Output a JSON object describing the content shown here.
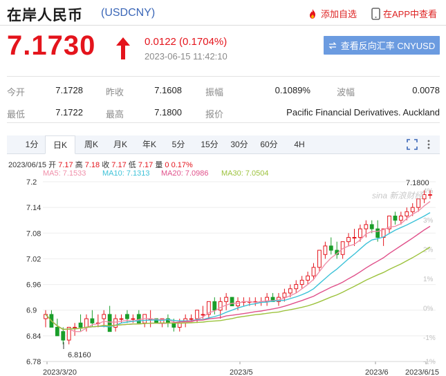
{
  "header": {
    "title": "在岸人民币",
    "code": "(USDCNY)",
    "add_watch": "添加自选",
    "open_app": "在APP中查看"
  },
  "quote": {
    "price": "7.1730",
    "change": "0.0122 (0.1704%)",
    "time": "2023-06-15 11:42:10",
    "reverse_button": "查看反向汇率 CNYUSD",
    "direction": "up",
    "up_color": "#e4141c"
  },
  "stats": {
    "open_label": "今开",
    "open": "7.1728",
    "prev_close_label": "昨收",
    "prev_close": "7.1608",
    "amplitude_label": "振幅",
    "amplitude": "0.1089%",
    "range_label": "波幅",
    "range": "0.0078",
    "low_label": "最低",
    "low": "7.1722",
    "high_label": "最高",
    "high": "7.1800",
    "source_label": "报价",
    "source": "Pacific Financial Derivatives. Auckland"
  },
  "tabs": [
    "1分",
    "日K",
    "周K",
    "月K",
    "年K",
    "5分",
    "15分",
    "30分",
    "60分",
    "4H"
  ],
  "active_tab": "日K",
  "toolbar_icons": [
    "fullscreen-icon",
    "more-icon"
  ],
  "ohlc_line": {
    "date": "2023/06/15",
    "open_label": "开",
    "open": "7.17",
    "high_label": "高",
    "high": "7.18",
    "close_label": "收",
    "close": "7.17",
    "low_label": "低",
    "low": "7.17",
    "vol_label": "量",
    "vol": "0",
    "pct": "0.17%"
  },
  "ma_legend": {
    "ma5": "MA5: 7.1533",
    "ma10": "MA10: 7.1313",
    "ma20": "MA20: 7.0986",
    "ma30": "MA30: 7.0504",
    "colors": {
      "ma5": "#f08fa9",
      "ma10": "#3cc2d8",
      "ma20": "#e0508a",
      "ma30": "#9cc23c"
    }
  },
  "chart_data": {
    "type": "candlestick",
    "y_ticks": [
      "7.2",
      "7.14",
      "7.08",
      "7.02",
      "6.96",
      "6.9",
      "6.84",
      "6.78"
    ],
    "ylim": [
      6.78,
      7.2
    ],
    "pct_ticks": [
      "4%",
      "3%",
      "2%",
      "1%",
      "0%",
      "-1%",
      "-1%"
    ],
    "x_labels": [
      "2023/3/20",
      "2023/5",
      "2023/6",
      "2023/6/15"
    ],
    "max_label": "7.1800",
    "min_label": "6.8160",
    "watermark": "sina 新浪财经",
    "candles": [
      [
        6.88,
        6.9,
        6.86,
        6.89
      ],
      [
        6.89,
        6.9,
        6.86,
        6.86
      ],
      [
        6.86,
        6.88,
        6.84,
        6.84
      ],
      [
        6.85,
        6.86,
        6.82,
        6.83
      ],
      [
        6.83,
        6.86,
        6.82,
        6.86
      ],
      [
        6.86,
        6.87,
        6.84,
        6.86
      ],
      [
        6.87,
        6.89,
        6.85,
        6.86
      ],
      [
        6.86,
        6.89,
        6.85,
        6.88
      ],
      [
        6.88,
        6.9,
        6.86,
        6.87
      ],
      [
        6.87,
        6.89,
        6.86,
        6.87
      ],
      [
        6.88,
        6.9,
        6.86,
        6.89
      ],
      [
        6.89,
        6.91,
        6.85,
        6.85
      ],
      [
        6.86,
        6.89,
        6.85,
        6.88
      ],
      [
        6.88,
        6.89,
        6.87,
        6.88
      ],
      [
        6.89,
        6.9,
        6.87,
        6.88
      ],
      [
        6.88,
        6.89,
        6.87,
        6.88
      ],
      [
        6.89,
        6.9,
        6.87,
        6.87
      ],
      [
        6.87,
        6.89,
        6.86,
        6.89
      ],
      [
        6.88,
        6.9,
        6.86,
        6.88
      ],
      [
        6.88,
        6.88,
        6.87,
        6.87
      ],
      [
        6.87,
        6.88,
        6.86,
        6.88
      ],
      [
        6.88,
        6.89,
        6.86,
        6.87
      ],
      [
        6.87,
        6.88,
        6.85,
        6.86
      ],
      [
        6.86,
        6.88,
        6.85,
        6.87
      ],
      [
        6.87,
        6.89,
        6.86,
        6.88
      ],
      [
        6.88,
        6.89,
        6.87,
        6.88
      ],
      [
        6.88,
        6.9,
        6.87,
        6.9
      ],
      [
        6.89,
        6.91,
        6.88,
        6.89
      ],
      [
        6.89,
        6.92,
        6.88,
        6.92
      ],
      [
        6.92,
        6.93,
        6.89,
        6.9
      ],
      [
        6.9,
        6.93,
        6.88,
        6.92
      ],
      [
        6.92,
        6.94,
        6.9,
        6.93
      ],
      [
        6.93,
        6.93,
        6.91,
        6.91
      ],
      [
        6.91,
        6.93,
        6.9,
        6.92
      ],
      [
        6.92,
        6.93,
        6.91,
        6.92
      ],
      [
        6.92,
        6.93,
        6.91,
        6.92
      ],
      [
        6.92,
        6.93,
        6.91,
        6.92
      ],
      [
        6.92,
        6.93,
        6.91,
        6.92
      ],
      [
        6.92,
        6.94,
        6.91,
        6.93
      ],
      [
        6.93,
        6.94,
        6.92,
        6.92
      ],
      [
        6.92,
        6.94,
        6.91,
        6.93
      ],
      [
        6.93,
        6.95,
        6.92,
        6.94
      ],
      [
        6.94,
        6.96,
        6.93,
        6.95
      ],
      [
        6.95,
        6.97,
        6.94,
        6.96
      ],
      [
        6.96,
        6.98,
        6.95,
        6.97
      ],
      [
        6.97,
        6.99,
        6.96,
        6.98
      ],
      [
        6.98,
        7.01,
        6.97,
        7.0
      ],
      [
        7.0,
        7.04,
        6.99,
        7.04
      ],
      [
        7.03,
        7.06,
        7.02,
        7.05
      ],
      [
        7.05,
        7.07,
        7.03,
        7.04
      ],
      [
        7.04,
        7.06,
        7.02,
        7.03
      ],
      [
        7.03,
        7.06,
        7.02,
        7.06
      ],
      [
        7.06,
        7.08,
        7.05,
        7.07
      ],
      [
        7.07,
        7.09,
        7.05,
        7.07
      ],
      [
        7.07,
        7.1,
        7.06,
        7.09
      ],
      [
        7.09,
        7.11,
        7.07,
        7.1
      ],
      [
        7.1,
        7.11,
        7.08,
        7.09
      ],
      [
        7.09,
        7.11,
        7.06,
        7.07
      ],
      [
        7.07,
        7.09,
        7.05,
        7.09
      ],
      [
        7.09,
        7.12,
        7.08,
        7.12
      ],
      [
        7.12,
        7.13,
        7.1,
        7.11
      ],
      [
        7.11,
        7.13,
        7.1,
        7.12
      ],
      [
        7.12,
        7.14,
        7.11,
        7.13
      ],
      [
        7.13,
        7.15,
        7.12,
        7.14
      ],
      [
        7.14,
        7.16,
        7.13,
        7.16
      ],
      [
        7.16,
        7.18,
        7.15,
        7.17
      ],
      [
        7.17,
        7.18,
        7.16,
        7.17
      ]
    ]
  }
}
